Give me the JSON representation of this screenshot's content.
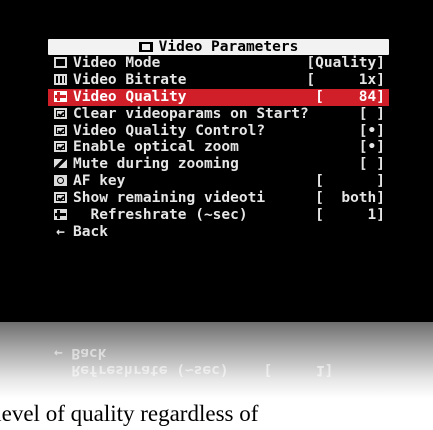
{
  "menu": {
    "title": "Video Parameters",
    "title_icon": "film-icon",
    "items": [
      {
        "label": "Video Mode",
        "value": "[Quality]",
        "icon": "mode-icon"
      },
      {
        "label": "Video Bitrate",
        "value": "[     1x]",
        "icon": "bars-icon"
      },
      {
        "label": "Video Quality",
        "value": "[    84]",
        "icon": "slider-icon",
        "selected": true
      },
      {
        "label": "Clear videoparams on Start?",
        "value": "[ ]",
        "icon": "checkbox-icon"
      },
      {
        "label": "Video Quality Control?",
        "value": "[•]",
        "icon": "checkbox-icon"
      },
      {
        "label": "Enable optical zoom",
        "value": "[•]",
        "icon": "checkbox-icon"
      },
      {
        "label": "Mute during zooming",
        "value": "[ ]",
        "icon": "zoom-icon"
      },
      {
        "label": "AF key",
        "value": "[      ]",
        "icon": "camera-icon"
      },
      {
        "label": "Show remaining videoti",
        "value": "[  both]",
        "icon": "checkbox-icon"
      },
      {
        "label": "  Refreshrate (~sec)",
        "value": "[     1]",
        "icon": "slider-icon"
      }
    ],
    "back_label": "Back",
    "back_icon": "back-arrow-icon"
  },
  "reflection": {
    "line1": "← Back",
    "line2": "  Refreshrate (~sec)    [     1]"
  },
  "caption": {
    "text": "d level of quality regardless of"
  },
  "colors": {
    "screen_bg": "#000000",
    "selection": "#d11f2a",
    "title_bg": "#f2f2f2",
    "text": "#e6e6e6"
  }
}
